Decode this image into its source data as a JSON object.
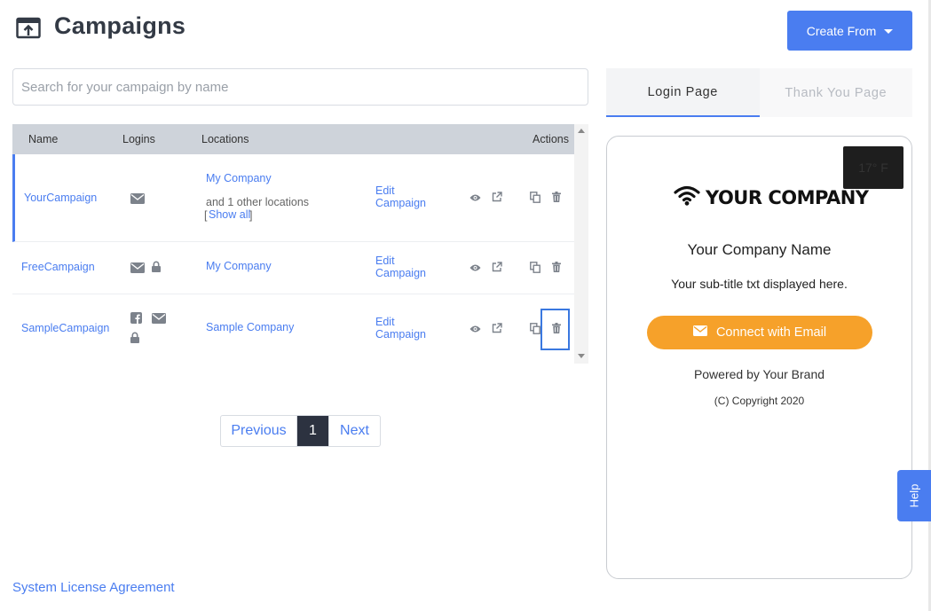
{
  "header": {
    "title": "Campaigns",
    "create_label": "Create From"
  },
  "search": {
    "placeholder": "Search for your campaign by name"
  },
  "table": {
    "columns": [
      "Name",
      "Logins",
      "Locations",
      "Actions"
    ],
    "rows": [
      {
        "name": "YourCampaign",
        "logins": [
          "envelope"
        ],
        "location": "My Company",
        "location_extra": "and 1 other locations",
        "show_all_prefix": "[",
        "show_all": "Show all",
        "show_all_suffix": "]",
        "edit": "Edit Campaign"
      },
      {
        "name": "FreeCampaign",
        "logins": [
          "envelope",
          "lock"
        ],
        "location": "My Company",
        "edit": "Edit Campaign"
      },
      {
        "name": "SampleCampaign",
        "logins": [
          "facebook",
          "envelope",
          "lock"
        ],
        "location": "Sample Company",
        "edit": "Edit Campaign"
      }
    ]
  },
  "pagination": {
    "previous": "Previous",
    "current": "1",
    "next": "Next"
  },
  "footer": {
    "license": "System License Agreement"
  },
  "preview": {
    "tabs": [
      "Login Page",
      "Thank You Page"
    ],
    "active_tab": "Login Page",
    "weather": "17° F",
    "logo_text": "YOUR COMPANY",
    "company_name": "Your Company Name",
    "subtitle": "Your sub-title txt displayed here.",
    "connect_label": "Connect with Email",
    "powered_by": "Powered by Your Brand",
    "copyright": "(C) Copyright 2020"
  },
  "help": {
    "label": "Help"
  },
  "colors": {
    "accent": "#4a7df0",
    "orange": "#f6a12a",
    "header_bg": "#ced3da",
    "dark": "#2c3240"
  }
}
